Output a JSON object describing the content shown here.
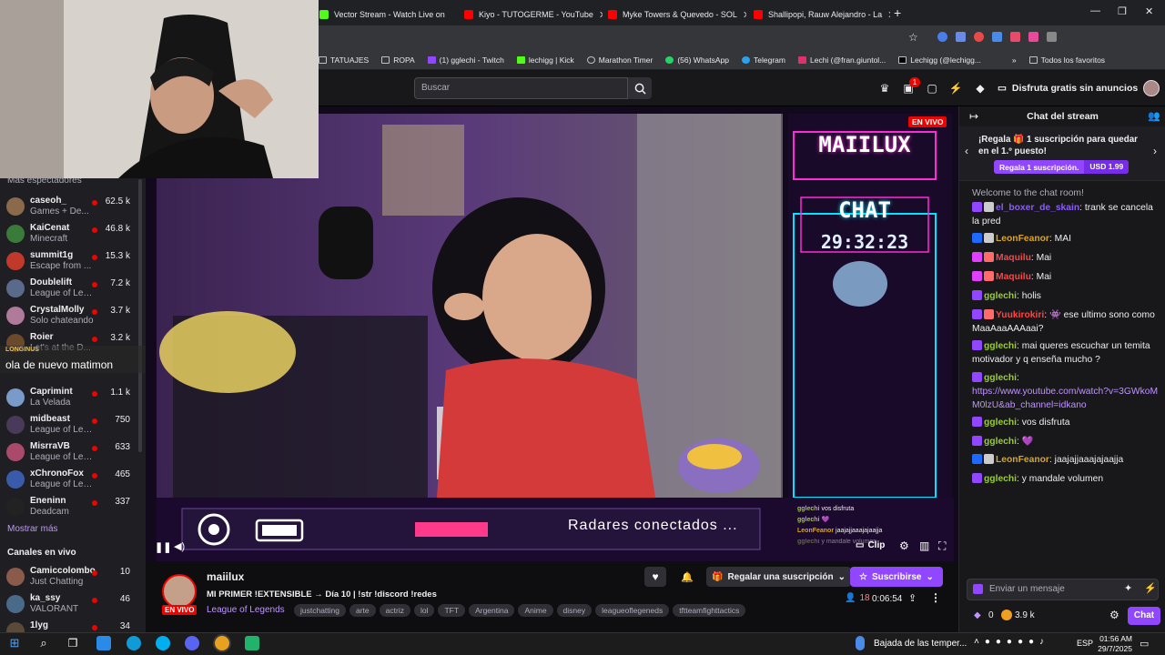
{
  "browser": {
    "tabs": [
      {
        "title": "Vector Stream - Watch Live on",
        "color": "#53fc18"
      },
      {
        "title": "Kiyo - TUTOGERME - YouTube",
        "color": "#ff0000"
      },
      {
        "title": "Myke Towers & Quevedo - SOL",
        "color": "#ff0000"
      },
      {
        "title": "Shallipopi, Rauw Alejandro - La",
        "color": "#ff0000"
      }
    ],
    "bookmarks": [
      "TATUAJES",
      "ROPA",
      "(1) gglechi - Twitch",
      "lechigg | Kick",
      "Marathon Timer",
      "(56) WhatsApp",
      "Telegram",
      "Lechi (@fran.giuntol...",
      "Lechigg (@lechigg...",
      "Todos los favoritos"
    ]
  },
  "header": {
    "search_placeholder": "Buscar",
    "notif_count": "1",
    "ad_free": "Disfruta gratis sin anuncios"
  },
  "sidebar": {
    "more_viewers": "Más espectadores",
    "channels": [
      {
        "name": "caseoh_",
        "game": "Games + De...",
        "viewers": "62.5 k",
        "color": "#8a6a4a"
      },
      {
        "name": "KaiCenat",
        "game": "Minecraft",
        "viewers": "46.8 k",
        "color": "#3a7a3a"
      },
      {
        "name": "summit1g",
        "game": "Escape from ...",
        "viewers": "15.3 k",
        "color": "#c0392b"
      },
      {
        "name": "Doublelift",
        "game": "League of Leg...",
        "viewers": "7.2 k",
        "color": "#5a6a8a"
      },
      {
        "name": "CrystalMolly",
        "game": "Solo chateando",
        "viewers": "3.7 k",
        "color": "#b07a9a"
      },
      {
        "name": "Roier",
        "game": "Let's at the D...",
        "viewers": "3.2 k",
        "color": "#6a4a2a"
      },
      {
        "name": "",
        "game": "",
        "viewers": "",
        "color": "#444"
      },
      {
        "name": "Caprimint",
        "game": "La Velada",
        "viewers": "1.1 k",
        "color": "#7a9aca"
      },
      {
        "name": "midbeast",
        "game": "League of Lege...",
        "viewers": "750",
        "color": "#4a3a5a"
      },
      {
        "name": "MisrraVB",
        "game": "League of Lege...",
        "viewers": "633",
        "color": "#aa4a6a"
      },
      {
        "name": "xChronoFox",
        "game": "League of Lege...",
        "viewers": "465",
        "color": "#3a5aaa"
      },
      {
        "name": "Eneninn",
        "game": "Deadcam",
        "viewers": "337",
        "color": "#222"
      }
    ],
    "show_more": "Mostrar más",
    "live_channels": "Canales en vivo",
    "live": [
      {
        "name": "Camiccolombo",
        "game": "Just Chatting",
        "viewers": "10",
        "color": "#8a5a4a"
      },
      {
        "name": "ka_ssy",
        "game": "VALORANT",
        "viewers": "46",
        "color": "#4a6a8a"
      },
      {
        "name": "1lyg",
        "game": "",
        "viewers": "34",
        "color": "#5a4a3a"
      }
    ]
  },
  "overlay_caption": {
    "user": "LONGINUS",
    "text": "ola de nuevo matimon"
  },
  "video": {
    "live_badge": "EN VIVO",
    "title": "MAIILUX",
    "chat_label": "CHAT",
    "timer": "29:32:23",
    "radar_text": "Radares conectados ...",
    "clip_label": "Clip",
    "mini_chat": [
      {
        "user": "gglechi",
        "text": "vos disfruta"
      },
      {
        "user": "gglechi",
        "text": "💜"
      },
      {
        "user": "LeonFeanor",
        "text": "jaajajjaaajajaajja"
      },
      {
        "user": "gglechi",
        "text": "y mandale volumen"
      }
    ]
  },
  "stream": {
    "streamer": "maiilux",
    "live": "EN VIVO",
    "title": "MI PRIMER !EXTENSIBLE → Día 10 | !str !discord !redes",
    "category": "League of Legends",
    "tags": [
      "justchatting",
      "arte",
      "actriz",
      "lol",
      "TFT",
      "Argentina",
      "Anime",
      "disney",
      "leagueoflegeneds",
      "tftteamfighttactics"
    ],
    "gift_sub": "Regalar una suscripción",
    "subscribe": "Suscribirse",
    "viewers": "18",
    "uptime": "0:06:54"
  },
  "chat": {
    "header": "Chat del stream",
    "gift_banner": "¡Regala 🎁 1 suscripción para quedar en el 1.º puesto!",
    "gift_button": "Regala 1 suscripción.",
    "price": "USD 1.99",
    "welcome": "Welcome to the chat room!",
    "messages": [
      {
        "user": "el_boxer_de_skain",
        "color": "#8a5cf6",
        "text": ": trank se cancela la pred"
      },
      {
        "user": "LeonFeanor",
        "color": "#daa520",
        "text": ": MAI"
      },
      {
        "user": "Maquilu",
        "color": "#ff4444",
        "text": ": Mai"
      },
      {
        "user": "Maquilu",
        "color": "#ff4444",
        "text": ": Mai"
      },
      {
        "user": "gglechi",
        "color": "#9acd32",
        "text": ": holis"
      },
      {
        "user": "Yuukirokiri",
        "color": "#ff4444",
        "text": ": 👾 ese ultimo sono como MaaAaaAAAaai?"
      },
      {
        "user": "gglechi",
        "color": "#9acd32",
        "text": ": mai queres escuchar un temita motivador y q enseña mucho ?"
      },
      {
        "user": "gglechi",
        "color": "#9acd32",
        "text": ":"
      },
      {
        "user": "gglechi",
        "color": "#9acd32",
        "text": ": vos disfruta"
      },
      {
        "user": "gglechi",
        "color": "#9acd32",
        "text": ": 💜"
      },
      {
        "user": "LeonFeanor",
        "color": "#daa520",
        "text": ": jaajajjaaajajaajja"
      },
      {
        "user": "gglechi",
        "color": "#9acd32",
        "text": ": y mandale volumen"
      }
    ],
    "link": "https://www.youtube.com/watch?v=3GWkoMM0lzU&ab_channel=idkano",
    "input_placeholder": "Enviar un mensaje",
    "points_a": "0",
    "points_b": "3.9 k",
    "chat_button": "Chat"
  },
  "taskbar": {
    "weather": "Bajada de las temper...",
    "lang": "ESP",
    "time": "01:56 AM",
    "date": "29/7/2025"
  }
}
